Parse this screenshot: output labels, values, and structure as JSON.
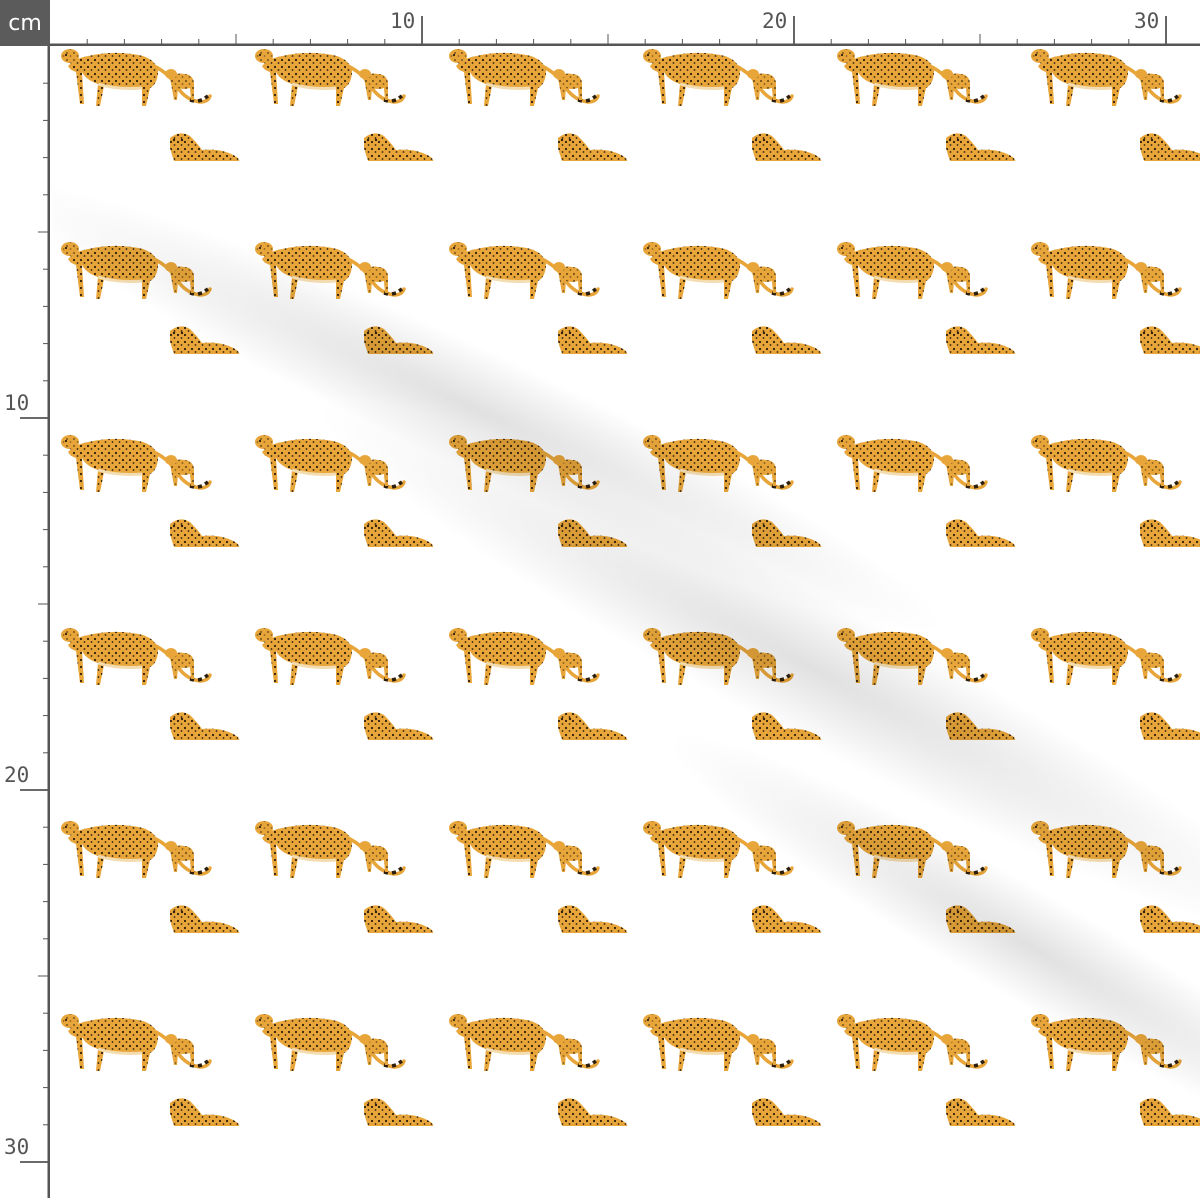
{
  "ruler": {
    "unit": "cm",
    "labels": [
      "10",
      "20",
      "30"
    ]
  },
  "pattern": {
    "motifs": [
      "cheetah-walking-with-cub",
      "cheetah-standing-with-sitting-cub"
    ],
    "colors": {
      "background": "#ffffff",
      "fur": "#e8a63a",
      "spots": "#2e1e0c",
      "light_fur": "#f3dcb0",
      "ruler_gray": "#5b5b5b"
    }
  }
}
